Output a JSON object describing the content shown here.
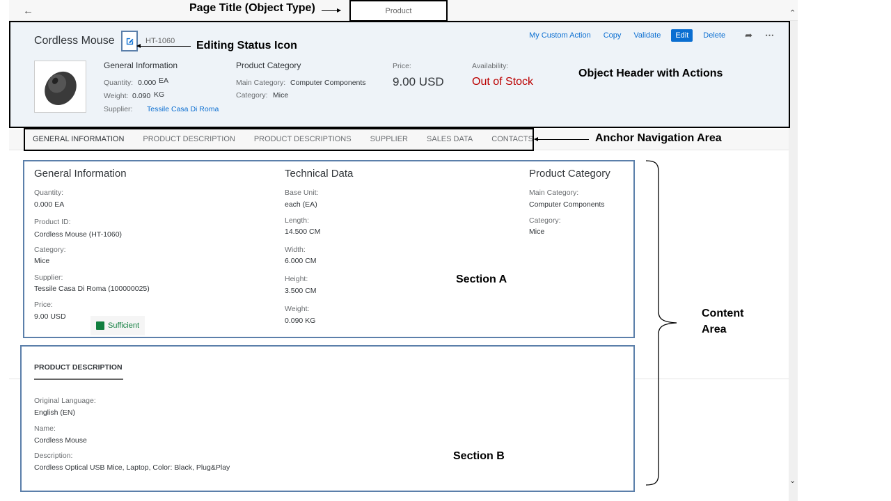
{
  "shell": {
    "page_title": "Product"
  },
  "header": {
    "title": "Cordless Mouse",
    "product_id": "HT-1060",
    "actions": [
      "My Custom Action",
      "Copy",
      "Validate",
      "Edit",
      "Delete"
    ],
    "general": {
      "title": "General Information",
      "quantity_label": "Quantity:",
      "quantity_value": "0.000",
      "quantity_unit": "EA",
      "weight_label": "Weight:",
      "weight_value": "0.090",
      "weight_unit": "KG",
      "supplier_label": "Supplier:",
      "supplier_value": "Tessile Casa Di Roma"
    },
    "category": {
      "title": "Product Category",
      "main_label": "Main Category:",
      "main_value": "Computer Components",
      "cat_label": "Category:",
      "cat_value": "Mice"
    },
    "price": {
      "label": "Price:",
      "value": "9.00  USD"
    },
    "availability": {
      "label": "Availability:",
      "value": "Out of Stock"
    }
  },
  "anchors": [
    "GENERAL INFORMATION",
    "PRODUCT DESCRIPTION",
    "PRODUCT DESCRIPTIONS",
    "SUPPLIER",
    "SALES DATA",
    "CONTACTS"
  ],
  "section_a": {
    "col1": {
      "title": "General Information",
      "fields": [
        {
          "label": "Quantity:",
          "value": "0.000 EA"
        },
        {
          "label": "Product ID:",
          "value": "Cordless Mouse (HT-1060)"
        },
        {
          "label": "Category:",
          "value": "Mice"
        },
        {
          "label": "Supplier:",
          "value": "Tessile Casa Di Roma (100000025)"
        },
        {
          "label": "Price:",
          "value": "9.00  USD"
        }
      ],
      "status": "Sufficient"
    },
    "col2": {
      "title": "Technical Data",
      "fields": [
        {
          "label": "Base Unit:",
          "value": "each (EA)"
        },
        {
          "label": "Length:",
          "value": "14.500 CM"
        },
        {
          "label": "Width:",
          "value": "6.000 CM"
        },
        {
          "label": "Height:",
          "value": "3.500 CM"
        },
        {
          "label": "Weight:",
          "value": "0.090 KG"
        }
      ]
    },
    "col3": {
      "title": "Product Category",
      "fields": [
        {
          "label": "Main Category:",
          "value": "Computer Components"
        },
        {
          "label": "Category:",
          "value": "Mice"
        }
      ]
    }
  },
  "section_b": {
    "title": "PRODUCT DESCRIPTION",
    "fields": [
      {
        "label": "Original Language:",
        "value": "English (EN)"
      },
      {
        "label": "Name:",
        "value": "Cordless Mouse"
      },
      {
        "label": "Description:",
        "value": "Cordless Optical USB Mice, Laptop, Color: Black, Plug&Play"
      }
    ]
  },
  "annotations": {
    "page_title": "Page Title (Object Type)",
    "editing_status": "Editing Status Icon",
    "object_header": "Object Header with Actions",
    "anchor_navigation": "Anchor Navigation Area",
    "section_a": "Section A",
    "section_b": "Section B",
    "content_area_1": "Content",
    "content_area_2": "Area"
  },
  "colors": {
    "accent": "#0a6ed1",
    "negative": "#bb0000",
    "positive": "#107e3e",
    "section_border": "#5b7faa",
    "header_bg": "#eef3f8"
  }
}
